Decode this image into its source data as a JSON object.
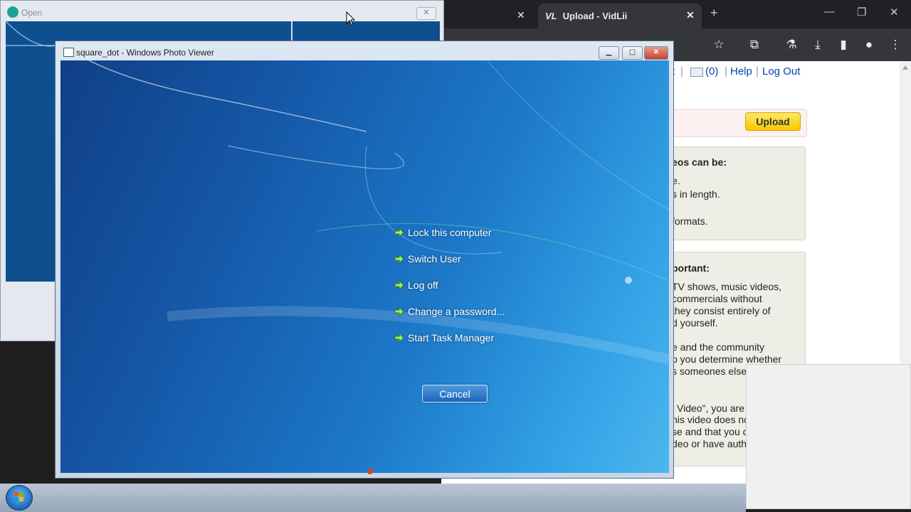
{
  "browser": {
    "active_tab_title": "Upload - VidLii",
    "active_tab_logo": "VL",
    "new_tab_label": "+",
    "nav_links": {
      "partial": "t",
      "inbox_count": "(0)",
      "help": "Help",
      "logout": "Log Out"
    },
    "upload_button": "Upload",
    "info_box_1": {
      "heading_fragment": "eos can be:",
      "lines": [
        "e.",
        "s in length.",
        "formats."
      ]
    },
    "info_box_2": {
      "heading_fragment": "portant:",
      "lines": [
        "TV shows, music videos,",
        "commercials without",
        "they consist entirely of",
        "d yourself.",
        "e and the community",
        "o you determine whether",
        "s someones else",
        "l Video\", you are",
        "his video does no",
        "se and that you c",
        "deo or have auth"
      ]
    }
  },
  "open_dialog": {
    "title": "Open"
  },
  "photo_viewer": {
    "title": "square_dot - Windows Photo Viewer",
    "security_menu": [
      "Lock this computer",
      "Switch User",
      "Log off",
      "Change a password...",
      "Start Task Manager"
    ],
    "cancel": "Cancel"
  },
  "colors": {
    "upload_button": "#f7c800",
    "link": "#0645ad",
    "desktop_blue": "#1c78c8"
  }
}
